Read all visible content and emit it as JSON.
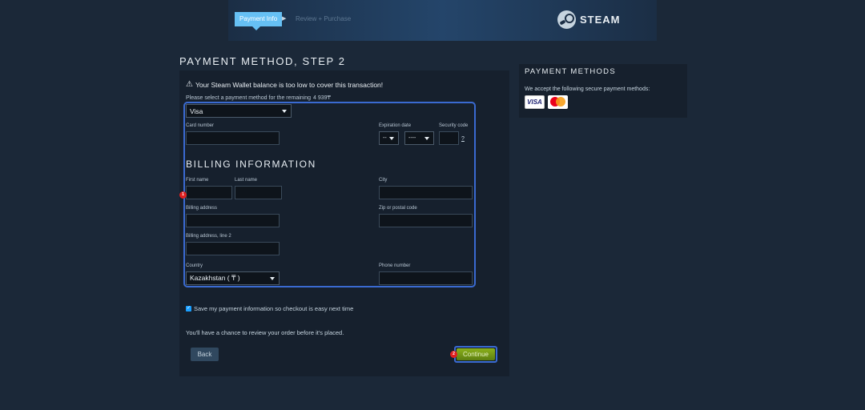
{
  "header": {
    "breadcrumb_active": "Payment Info",
    "breadcrumb_next": "Review + Purchase",
    "logo_text": "STEAM"
  },
  "page": {
    "title": "PAYMENT METHOD, STEP 2"
  },
  "form": {
    "warning": "Your Steam Wallet balance is too low to cover this transaction!",
    "prompt": "Please select a payment method for the remaining",
    "remaining_amount": "4 939₸",
    "payment_method_value": "Visa",
    "card_number_label": "Card number",
    "expiration_label": "Expiration date",
    "exp_month_value": "--",
    "exp_year_value": "----",
    "security_code_label": "Security code",
    "security_help": "?",
    "billing_title": "BILLING INFORMATION",
    "first_name_label": "First name",
    "last_name_label": "Last name",
    "city_label": "City",
    "billing_address_label": "Billing address",
    "zip_label": "Zip or postal code",
    "billing_address2_label": "Billing address, line 2",
    "country_label": "Country",
    "country_value": "Kazakhstan ( ₸ )",
    "phone_label": "Phone number",
    "save_info_label": "Save my payment information so checkout is easy next time",
    "save_info_checked": true,
    "review_note": "You'll have a chance to review your order before it's placed.",
    "back_label": "Back",
    "continue_label": "Continue"
  },
  "markers": {
    "first": "1",
    "second": "2"
  },
  "sidebar": {
    "title": "PAYMENT METHODS",
    "text": "We accept the following secure payment methods:",
    "visa_label": "VISA",
    "cards": [
      "visa-icon",
      "mastercard-icon"
    ]
  },
  "colors": {
    "background": "#1b2838",
    "panel": "#16202d",
    "accent": "#66c0f4",
    "focus": "#3a6ad1",
    "continue": "#7ea21a"
  }
}
